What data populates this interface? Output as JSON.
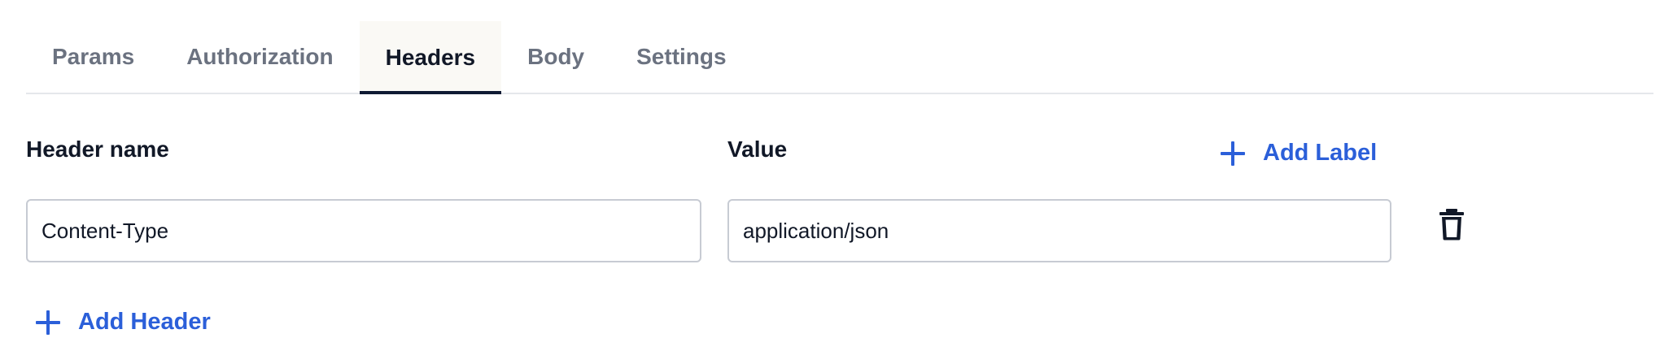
{
  "tabs": [
    {
      "label": "Params"
    },
    {
      "label": "Authorization"
    },
    {
      "label": "Headers"
    },
    {
      "label": "Body"
    },
    {
      "label": "Settings"
    }
  ],
  "active_tab": "Headers",
  "columns": {
    "header_name_label": "Header name",
    "value_label": "Value",
    "add_label_button": "Add Label"
  },
  "headers": [
    {
      "name": "Content-Type",
      "value": "application/json"
    }
  ],
  "add_header_button": "Add Header",
  "colors": {
    "accent": "#2b5fd9",
    "active_tab_bg": "#faf9f5",
    "active_tab_underline": "#0f1a33",
    "text_dark": "#111827",
    "text_muted": "#6b7280"
  },
  "icons": {
    "delete": "trash-icon",
    "add": "plus-icon"
  }
}
